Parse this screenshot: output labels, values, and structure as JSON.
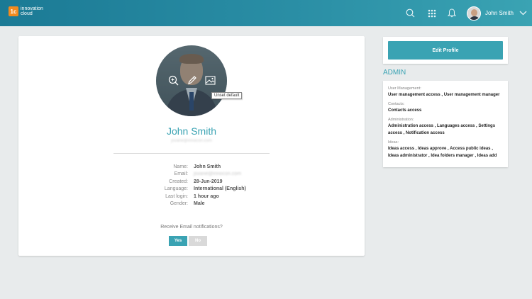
{
  "header": {
    "logo_mark": "1c",
    "logo_line1": "innovation",
    "logo_line2": "cloud",
    "user_name": "John Smith",
    "icons": [
      "search-icon",
      "apps-grid-icon",
      "bell-icon",
      "chevron-down-icon"
    ],
    "colors": {
      "bar_start": "#1b7a95",
      "bar_end": "#3aa3b3",
      "logo_accent": "#f28a1e"
    }
  },
  "profile": {
    "name": "John Smith",
    "email": "jsvane@innocon.com",
    "photo_tooltip": "Unset default",
    "photo_actions": [
      "zoom-icon",
      "edit-pencil-icon",
      "image-icon"
    ],
    "details": [
      {
        "label": "Name:",
        "value": "John Smith",
        "blurred": false
      },
      {
        "label": "Email:",
        "value": "jsvane@innocon.com",
        "blurred": true
      },
      {
        "label": "Created:",
        "value": "28-Jun-2019",
        "blurred": false
      },
      {
        "label": "Language:",
        "value": "International (English)",
        "blurred": false
      },
      {
        "label": "Last login:",
        "value": "1 hour ago",
        "blurred": false
      },
      {
        "label": "Gender:",
        "value": "Male",
        "blurred": false
      }
    ],
    "notifications_label": "Receive Email notifications?",
    "yes_label": "Yes",
    "no_label": "No",
    "selected": "Yes",
    "accent": "#3aa3b3"
  },
  "side": {
    "edit_button": "Edit Profile",
    "admin_title": "ADMIN",
    "groups": [
      {
        "title": "User Management:",
        "items": "User management access , User management manager"
      },
      {
        "title": "Contacts:",
        "items": "Contacts access"
      },
      {
        "title": "Administration:",
        "items": "Administration access , Languages access , Settings access , Notification access"
      },
      {
        "title": "Ideas:",
        "items": "Ideas access , Ideas approve , Access public ideas , Ideas administrator , Idea folders manager , Ideas add"
      }
    ]
  }
}
